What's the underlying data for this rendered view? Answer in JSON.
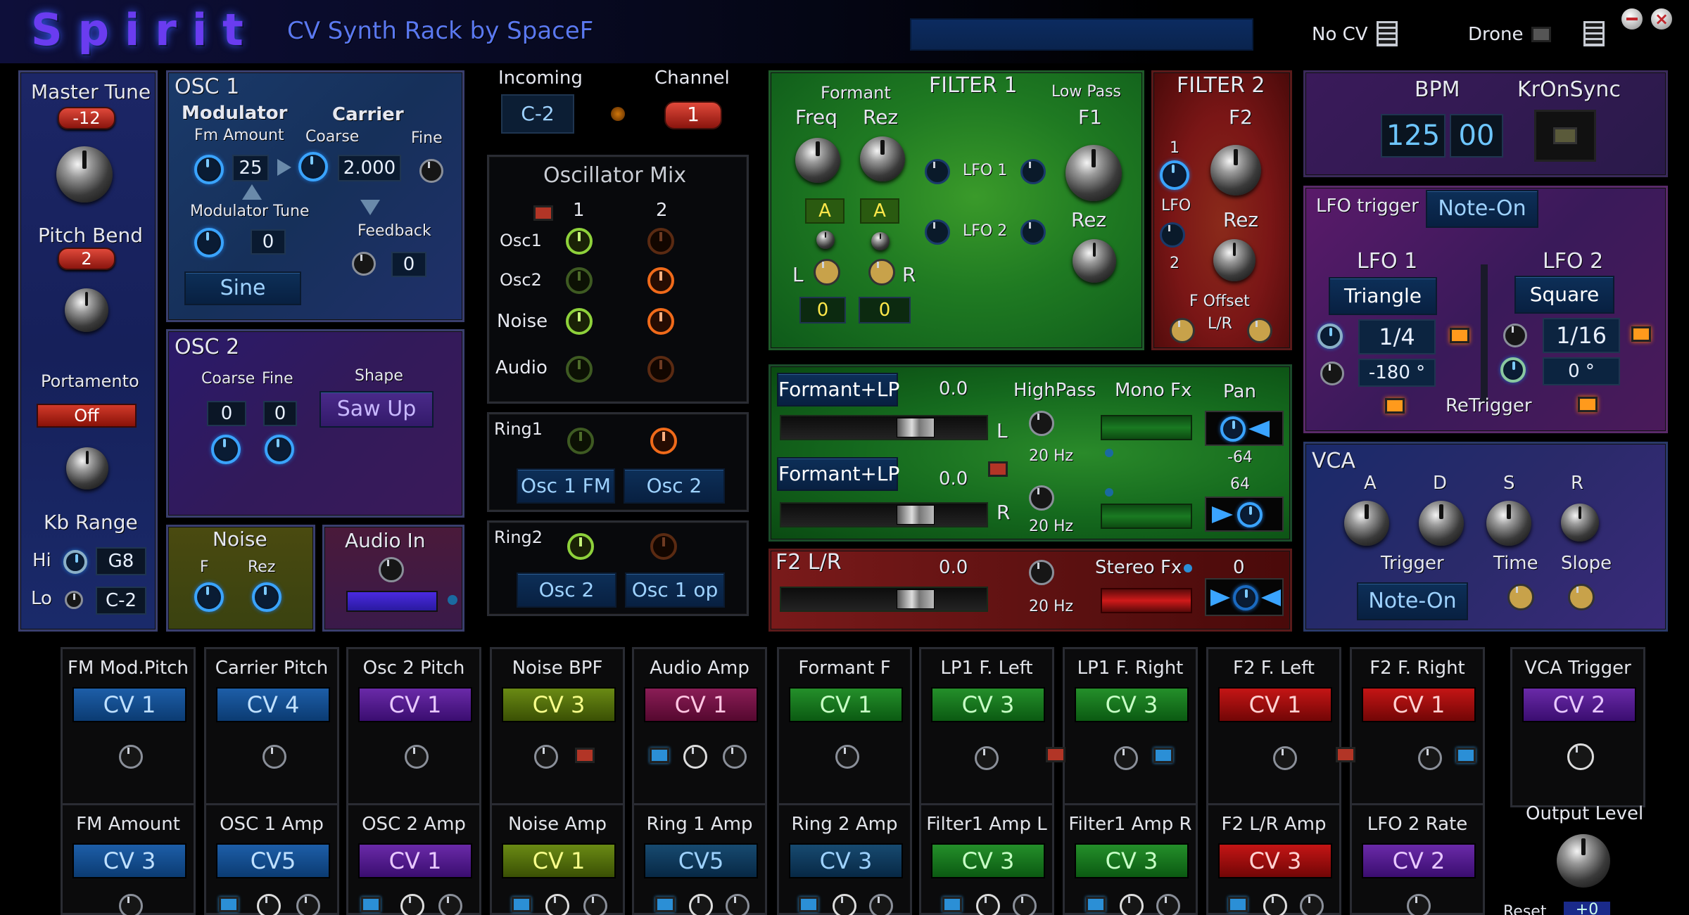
{
  "app": {
    "title": "Spirit",
    "subtitle": "CV Synth Rack by SpaceF",
    "nocv_label": "No CV",
    "drone_label": "Drone"
  },
  "master": {
    "master_tune_label": "Master Tune",
    "master_tune_value": "-12",
    "pitch_bend_label": "Pitch Bend",
    "pitch_bend_value": "2",
    "portamento_label": "Portamento",
    "portamento_value": "Off",
    "kb_range_label": "Kb Range",
    "hi_label": "Hi",
    "hi_value": "G8",
    "lo_label": "Lo",
    "lo_value": "C-2"
  },
  "osc1": {
    "title": "OSC 1",
    "modulator_label": "Modulator",
    "carrier_label": "Carrier",
    "fm_amount_label": "Fm Amount",
    "fm_amount_value": "25",
    "coarse_label": "Coarse",
    "coarse_value": "2.000",
    "fine_label": "Fine",
    "modulator_tune_label": "Modulator Tune",
    "modulator_tune_value": "0",
    "feedback_label": "Feedback",
    "feedback_value": "0",
    "wave": "Sine"
  },
  "osc2": {
    "title": "OSC 2",
    "coarse_label": "Coarse",
    "fine_label": "Fine",
    "coarse_value": "0",
    "fine_value": "0",
    "shape_label": "Shape",
    "shape_value": "Saw Up"
  },
  "noise": {
    "title": "Noise",
    "f_label": "F",
    "rez_label": "Rez"
  },
  "audio_in": {
    "title": "Audio In"
  },
  "incoming": {
    "label": "Incoming",
    "value": "C-2",
    "channel_label": "Channel",
    "channel_value": "1"
  },
  "osc_mix": {
    "title": "Oscillator Mix",
    "col1": "1",
    "col2": "2",
    "rows": [
      "Osc1",
      "Osc2",
      "Noise",
      "Audio"
    ]
  },
  "ring1": {
    "label": "Ring1",
    "src1": "Osc 1 FM",
    "src2": "Osc 2"
  },
  "ring2": {
    "label": "Ring2",
    "src1": "Osc 2",
    "src2": "Osc 1 op"
  },
  "filter1": {
    "title": "FILTER 1",
    "formant_label": "Formant",
    "freq_label": "Freq",
    "rez_label": "Rez",
    "lowpass_label": "Low Pass",
    "f1_label": "F1",
    "lfo1_label": "LFO 1",
    "lfo2_label": "LFO 2",
    "rez2_label": "Rez",
    "a1": "A",
    "a2": "A",
    "l_label": "L",
    "r_label": "R",
    "v1": "0",
    "v2": "0"
  },
  "filter2": {
    "title": "FILTER 2",
    "f2_label": "F2",
    "n1": "1",
    "lfo_label": "LFO",
    "n2": "2",
    "rez_label": "Rez",
    "foffset_label": "F Offset",
    "lr_label": "L/R"
  },
  "mixer": {
    "row1_mode": "Formant+LP",
    "row1_val": "0.0",
    "row2_mode": "Formant+LP",
    "row2_val": "0.0",
    "row3_mode": "F2 L/R",
    "row3_val": "0.0",
    "highpass_label": "HighPass",
    "monofx_label": "Mono Fx",
    "pan_label": "Pan",
    "l_label": "L",
    "r_label": "R",
    "hz1": "20 Hz",
    "hz2": "20 Hz",
    "hz3": "20 Hz",
    "pan_a": "-64",
    "pan_b": "64",
    "stereofx_label": "Stereo Fx",
    "stereofx_val": "0"
  },
  "bpm": {
    "label": "BPM",
    "v1": "125",
    "v2": "00",
    "kronsync_label": "KrOnSync"
  },
  "lfo": {
    "trigger_label": "LFO trigger",
    "trigger_value": "Note-On",
    "lfo1_label": "LFO 1",
    "lfo1_shape": "Triangle",
    "lfo1_rate": "1/4",
    "lfo1_phase": "-180 °",
    "lfo2_label": "LFO 2",
    "lfo2_shape": "Square",
    "lfo2_rate": "1/16",
    "lfo2_phase": "0 °",
    "retrigger_label": "ReTrigger"
  },
  "vca": {
    "title": "VCA",
    "a": "A",
    "d": "D",
    "s": "S",
    "r": "R",
    "trigger_label": "Trigger",
    "trigger_value": "Note-On",
    "time_label": "Time",
    "slope_label": "Slope"
  },
  "cv_row1": [
    {
      "title": "FM Mod.Pitch",
      "cv": "CV 1",
      "c": "cvb"
    },
    {
      "title": "Carrier Pitch",
      "cv": "CV 4",
      "c": "cvb"
    },
    {
      "title": "Osc 2 Pitch",
      "cv": "CV 1",
      "c": "cvp"
    },
    {
      "title": "Noise BPF",
      "cv": "CV 3",
      "c": "cvy"
    },
    {
      "title": "Audio Amp",
      "cv": "CV 1",
      "c": "cvm"
    },
    {
      "title": "Formant F",
      "cv": "CV 1",
      "c": "cvg"
    },
    {
      "title": "LP1 F. Left",
      "cv": "CV 3",
      "c": "cvg"
    },
    {
      "title": "LP1 F. Right",
      "cv": "CV 3",
      "c": "cvg"
    },
    {
      "title": "F2 F. Left",
      "cv": "CV 1",
      "c": "cvr"
    },
    {
      "title": "F2 F. Right",
      "cv": "CV 1",
      "c": "cvr"
    },
    {
      "title": "VCA Trigger",
      "cv": "CV 2",
      "c": "cvp"
    }
  ],
  "cv_row2": [
    {
      "title": "FM Amount",
      "cv": "CV 3",
      "c": "cvb"
    },
    {
      "title": "OSC 1 Amp",
      "cv": "CV5",
      "c": "cvb"
    },
    {
      "title": "OSC 2 Amp",
      "cv": "CV 1",
      "c": "cvp"
    },
    {
      "title": "Noise Amp",
      "cv": "CV 1",
      "c": "cvy"
    },
    {
      "title": "Ring 1 Amp",
      "cv": "CV5",
      "c": "cvn"
    },
    {
      "title": "Ring 2 Amp",
      "cv": "CV 3",
      "c": "cvn"
    },
    {
      "title": "Filter1 Amp L",
      "cv": "CV 3",
      "c": "cvg"
    },
    {
      "title": "Filter1 Amp R",
      "cv": "CV 3",
      "c": "cvg"
    },
    {
      "title": "F2 L/R Amp",
      "cv": "CV 3",
      "c": "cvr"
    },
    {
      "title": "LFO 2 Rate",
      "cv": "CV 2",
      "c": "cvp"
    }
  ],
  "output": {
    "label": "Output Level",
    "reset_label": "Reset",
    "reset_value": "+0"
  },
  "colors": {
    "accent": "#3aa4ff",
    "filter1_bg": "#1f7a2a",
    "filter2_bg": "#7a1616",
    "lfo_bg": "#4a1a5a",
    "vca_bg": "#2a2a6a"
  }
}
